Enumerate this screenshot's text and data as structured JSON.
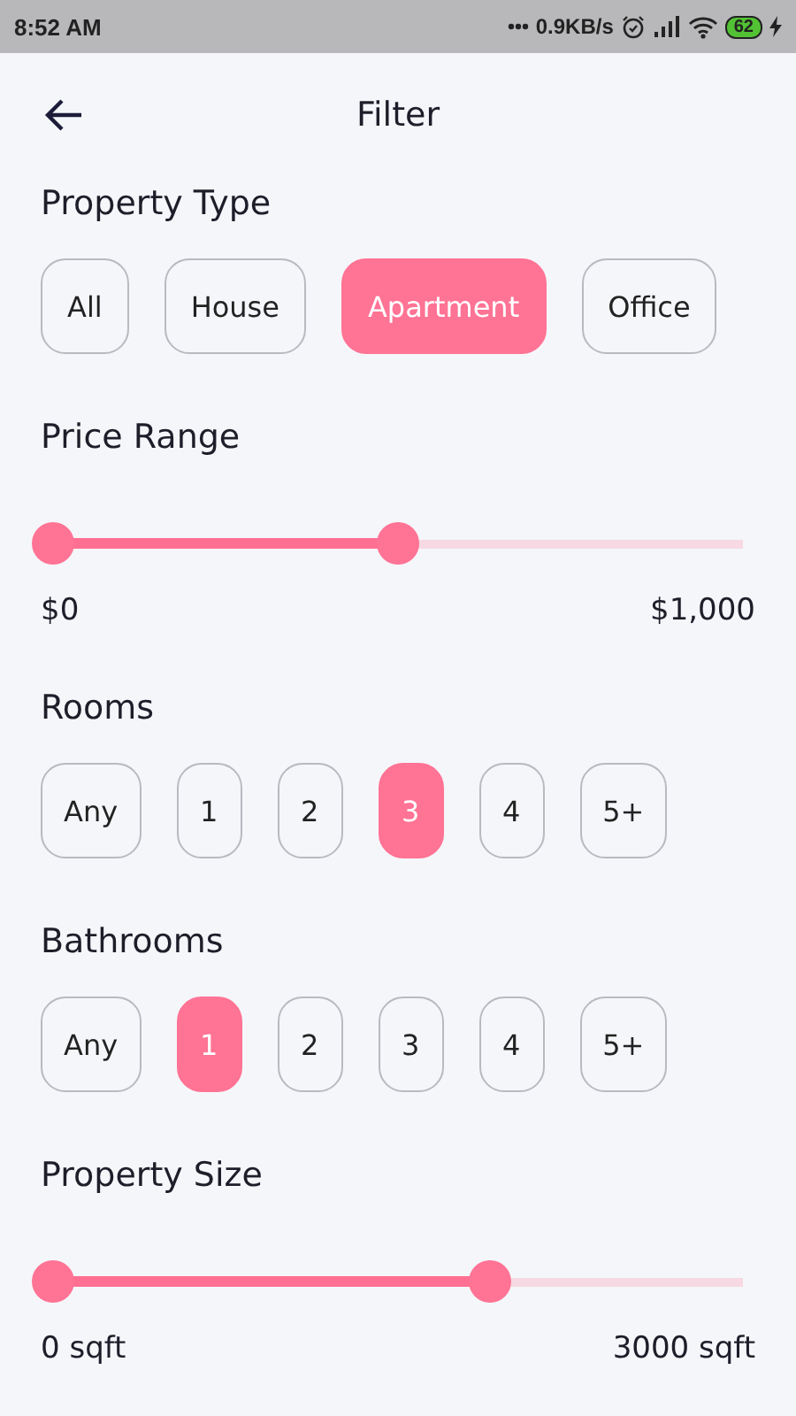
{
  "status_bar": {
    "time": "8:52 AM",
    "speed": "0.9KB/s",
    "battery": "62"
  },
  "header": {
    "title": "Filter"
  },
  "property_type": {
    "title": "Property Type",
    "options": [
      {
        "label": "All",
        "selected": false
      },
      {
        "label": "House",
        "selected": false
      },
      {
        "label": "Apartment",
        "selected": true
      },
      {
        "label": "Office",
        "selected": false
      }
    ]
  },
  "price_range": {
    "title": "Price Range",
    "low": {
      "level": 0
    },
    "high": {
      "level": 0.5
    },
    "min_label": "$0",
    "max_label": "$1,000"
  },
  "rooms": {
    "title": "Rooms",
    "options": [
      {
        "label": "Any",
        "selected": false
      },
      {
        "label": "1",
        "selected": false
      },
      {
        "label": "2",
        "selected": false
      },
      {
        "label": "3",
        "selected": true
      },
      {
        "label": "4",
        "selected": false
      },
      {
        "label": "5+",
        "selected": false
      }
    ]
  },
  "bathrooms": {
    "title": "Bathrooms",
    "options": [
      {
        "label": "Any",
        "selected": false
      },
      {
        "label": "1",
        "selected": true
      },
      {
        "label": "2",
        "selected": false
      },
      {
        "label": "3",
        "selected": false
      },
      {
        "label": "4",
        "selected": false
      },
      {
        "label": "5+",
        "selected": false
      }
    ]
  },
  "property_size": {
    "title": "Property Size",
    "low": {
      "level": 0
    },
    "high": {
      "level": 0.633
    },
    "min_label": "0 sqft",
    "max_label": "3000 sqft"
  }
}
